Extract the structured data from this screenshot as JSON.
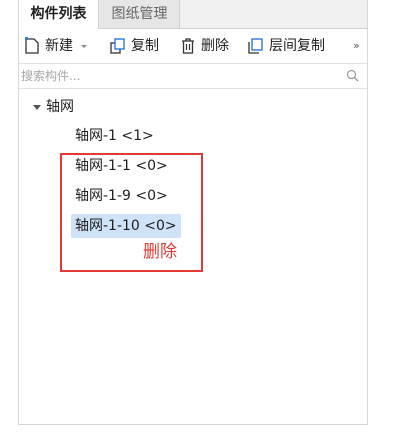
{
  "tabs": [
    {
      "label": "构件列表",
      "active": true
    },
    {
      "label": "图纸管理",
      "active": false
    }
  ],
  "toolbar": {
    "new_label": "新建",
    "copy_label": "复制",
    "delete_label": "删除",
    "layer_copy_label": "层间复制",
    "more_label": "»"
  },
  "search": {
    "placeholder": "搜索构件..."
  },
  "tree": {
    "root_label": "轴网",
    "children": [
      {
        "label": "轴网-1 <1>"
      },
      {
        "label": "轴网-1-1 <0>"
      },
      {
        "label": "轴网-1-9 <0>"
      },
      {
        "label": "轴网-1-10 <0>"
      }
    ]
  },
  "annotation": {
    "text": "删除",
    "color": "#e53935"
  },
  "colors": {
    "selection": "#cfe2f7",
    "accent": "#1e6fd9"
  }
}
